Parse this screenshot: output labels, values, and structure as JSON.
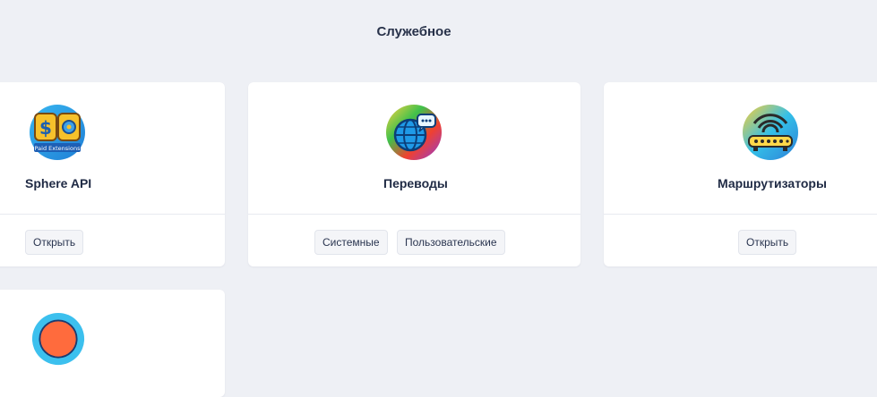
{
  "section": {
    "title": "Служебное"
  },
  "cards": [
    {
      "title": "Sphere API",
      "icon": "paid-extensions-icon",
      "icon_caption": "Paid Extensions",
      "actions": [
        "Открыть"
      ]
    },
    {
      "title": "Переводы",
      "icon": "globe-chat-icon",
      "actions": [
        "Системные",
        "Пользовательские"
      ]
    },
    {
      "title": "Маршрутизаторы",
      "icon": "router-icon",
      "actions": [
        "Открыть"
      ]
    },
    {
      "title": "",
      "icon": "app-icon",
      "actions": []
    }
  ]
}
